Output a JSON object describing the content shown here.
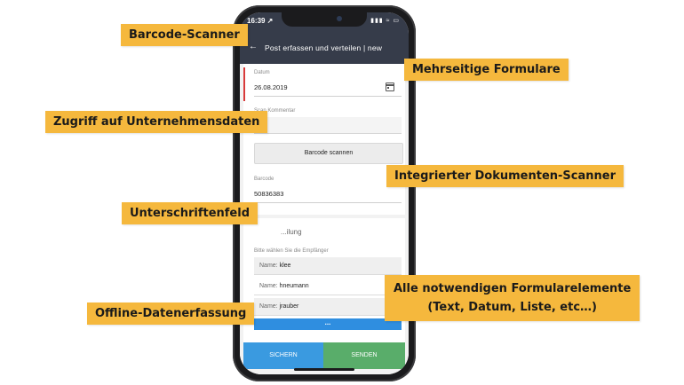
{
  "status": {
    "time": "16:39 ↗",
    "icons": "▮▮▮ ≈ ▭"
  },
  "header": {
    "back": "←",
    "title": "Post erfassen und verteilen | new"
  },
  "form": {
    "date_label": "Datum",
    "date_value": "26.08.2019",
    "comment_label": "Scan Kommentar",
    "comment_value": "",
    "scan_button": "Barcode scannen",
    "barcode_label": "Barcode",
    "barcode_value": "50836383"
  },
  "distribution": {
    "title": "...ilung",
    "hint": "Bitte wählen Sie die Empfänger",
    "key": "Name:",
    "recipients": [
      "klee",
      "hneumann",
      "jrauber"
    ],
    "more": "..."
  },
  "actions": {
    "save": "SICHERN",
    "send": "SENDEN"
  },
  "callouts": {
    "barcode": "Barcode-Scanner",
    "multipage": "Mehrseitige Formulare",
    "company_data": "Zugriff auf Unternehmensdaten",
    "doc_scanner": "Integrierter Dokumenten-Scanner",
    "signature": "Unterschriftenfeld",
    "form_elements_1": "Alle notwendigen Formularelemente",
    "form_elements_2": "(Text, Datum, Liste, etc…)",
    "offline": "Offline-Datenerfassung"
  },
  "colors": {
    "callout_bg": "#f5b83d",
    "header_bg": "#363c4a",
    "save_btn": "#3a9ae0",
    "send_btn": "#59ad6a",
    "required_marker": "#d83a3a"
  },
  "icons": [
    "back-arrow-icon",
    "calendar-icon",
    "signal-icon",
    "wifi-icon",
    "battery-icon"
  ]
}
